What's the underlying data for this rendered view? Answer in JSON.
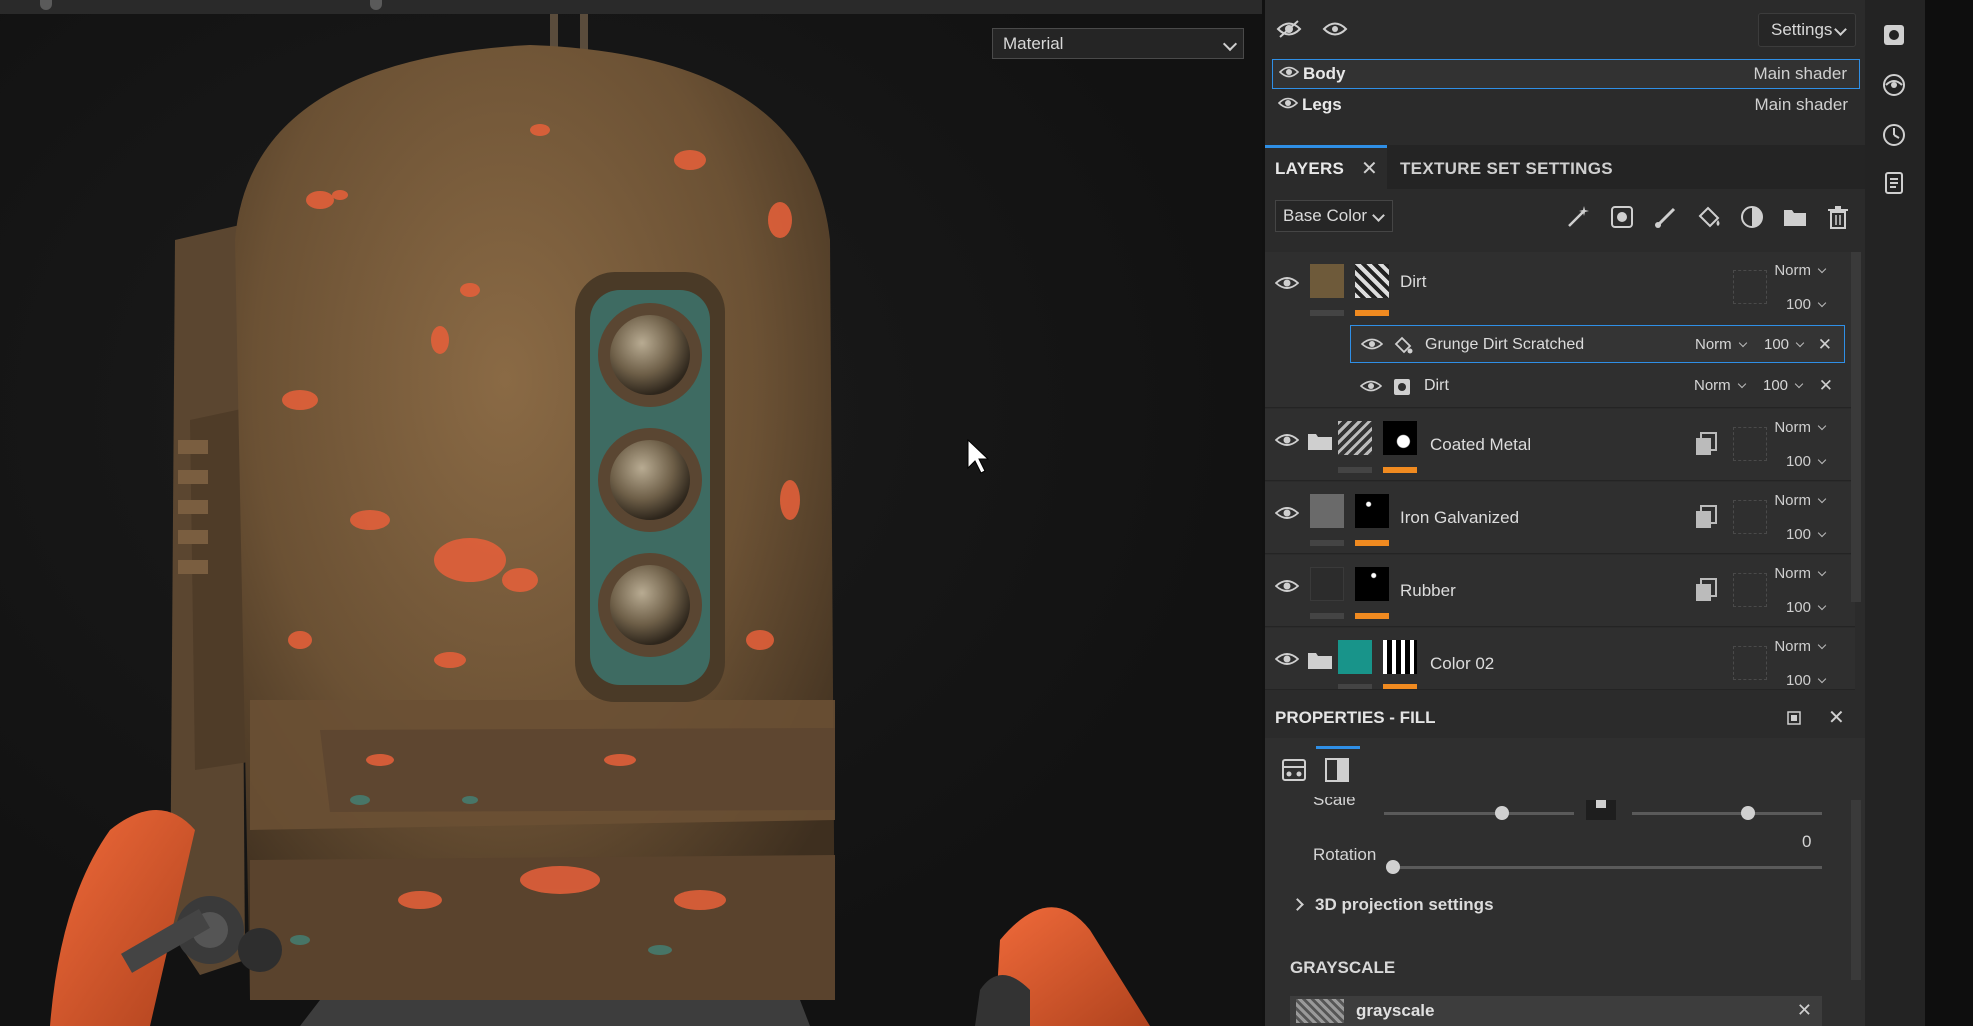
{
  "viewport": {
    "mode_select": "Material"
  },
  "texture_sets": {
    "settings_label": "Settings",
    "items": [
      {
        "name": "Body",
        "shader": "Main shader",
        "selected": true
      },
      {
        "name": "Legs",
        "shader": "Main shader",
        "selected": false
      }
    ]
  },
  "tabs": {
    "layers": "LAYERS",
    "texture_set_settings": "TEXTURE SET SETTINGS"
  },
  "layers_toolbar": {
    "channel": "Base Color"
  },
  "layers": [
    {
      "name": "Dirt",
      "blend": "Norm",
      "opacity": "100",
      "thumb_color": "#6e5a3a",
      "has_folder": false
    },
    {
      "name": "Coated Metal",
      "blend": "Norm",
      "opacity": "100",
      "thumb_color": "#3a3a3a",
      "has_folder": true
    },
    {
      "name": "Iron Galvanized",
      "blend": "Norm",
      "opacity": "100",
      "thumb_color": "#6a6a6a",
      "has_folder": false
    },
    {
      "name": "Rubber",
      "blend": "Norm",
      "opacity": "100",
      "thumb_color": "#2c2c2c",
      "has_folder": false
    },
    {
      "name": "Color 02",
      "blend": "Norm",
      "opacity": "100",
      "thumb_color": "#18948a",
      "has_folder": true
    }
  ],
  "sublayers": [
    {
      "name": "Grunge Dirt Scratched",
      "blend": "Norm",
      "opacity": "100",
      "selected": true
    },
    {
      "name": "Dirt",
      "blend": "Norm",
      "opacity": "100",
      "selected": false
    }
  ],
  "properties": {
    "title": "PROPERTIES - FILL",
    "scale_label": "Scale",
    "rotation_label": "Rotation",
    "rotation_value": "0",
    "projection_label": "3D projection settings",
    "grayscale_header": "GRAYSCALE",
    "grayscale_name": "grayscale"
  },
  "colors": {
    "accent": "#2f8fe6",
    "mask_bar": "#f08a20",
    "selection_border": "#2f8fe6"
  }
}
